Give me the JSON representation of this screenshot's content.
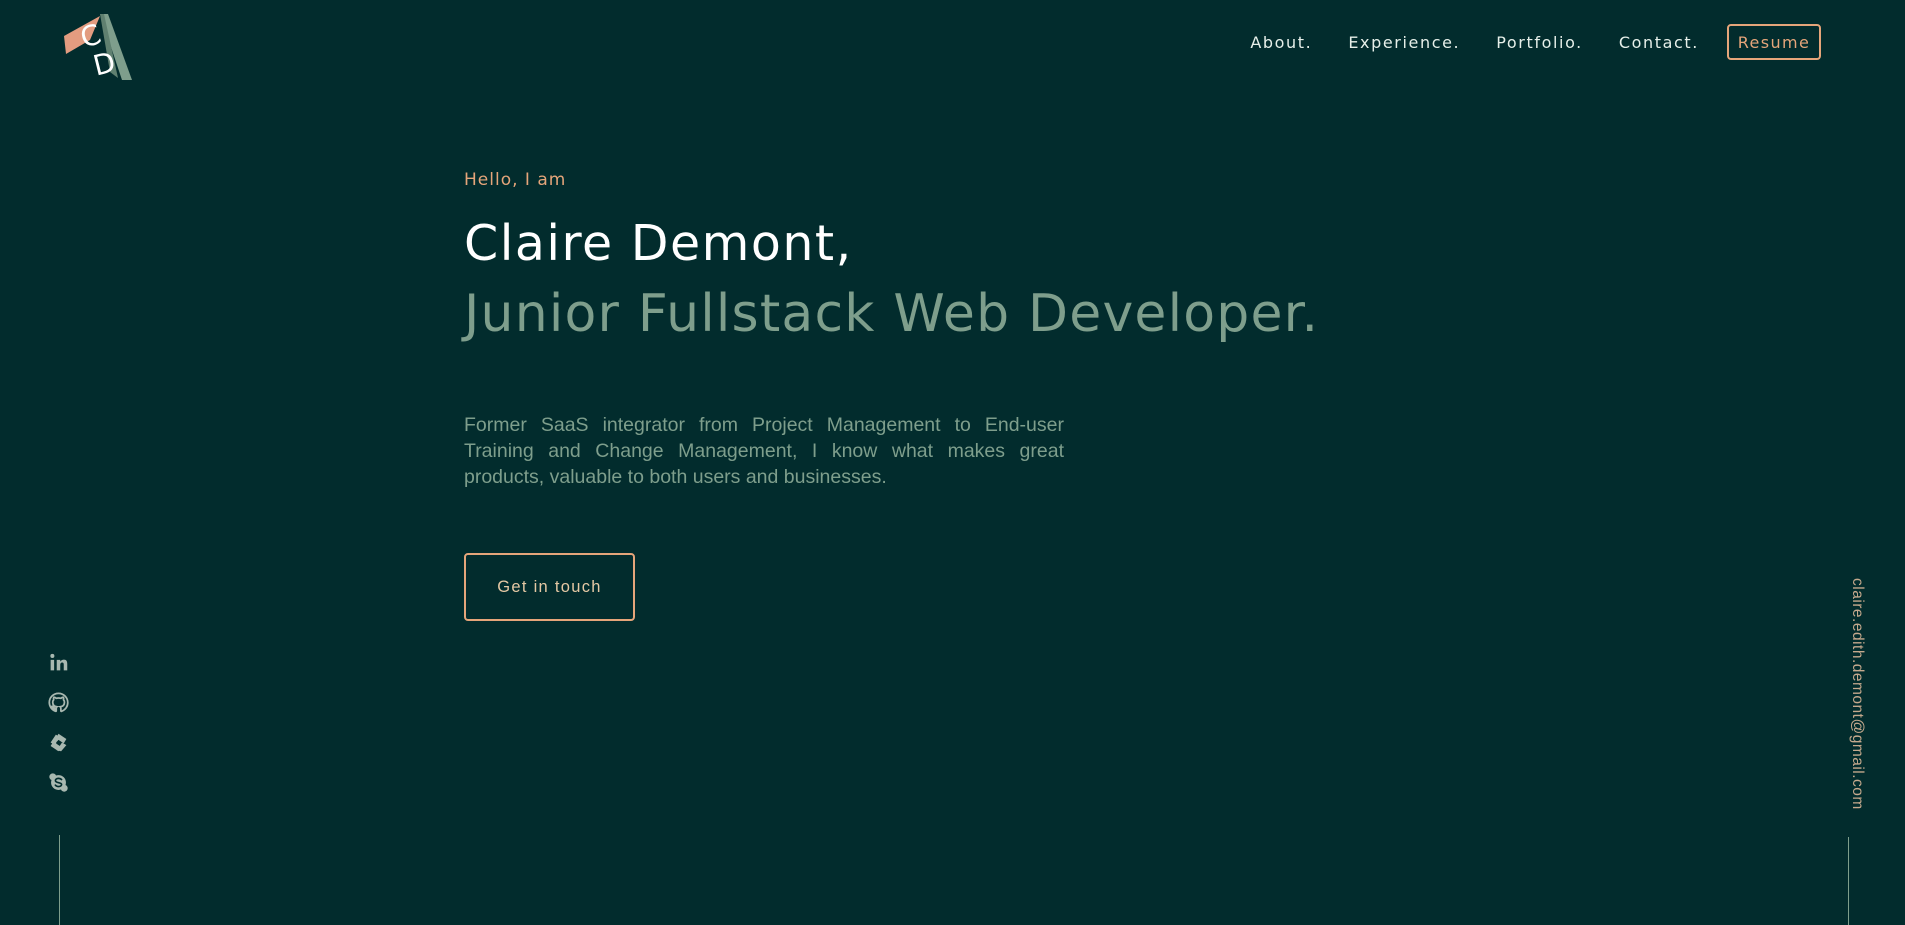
{
  "header": {
    "logo_letters": "CD",
    "nav": [
      {
        "label": "About."
      },
      {
        "label": "Experience."
      },
      {
        "label": "Portfolio."
      },
      {
        "label": "Contact."
      }
    ],
    "resume_label": "Resume"
  },
  "hero": {
    "greeting": "Hello, I am",
    "name": "Claire Demont,",
    "role": "Junior Fullstack Web Developer.",
    "bio": "Former SaaS integrator from Project Management to End-user Training and Change Management, I know what makes great products, valuable to both users and businesses.",
    "cta_label": "Get in touch"
  },
  "social": [
    {
      "icon": "linkedin-icon"
    },
    {
      "icon": "github-icon"
    },
    {
      "icon": "codepen-icon"
    },
    {
      "icon": "skype-icon"
    }
  ],
  "email": "claire.edith.demont@gmail.com",
  "colors": {
    "background": "#022c2d",
    "accent": "#e5a57a",
    "muted_green": "#7e9e8c",
    "white": "#ffffff"
  }
}
